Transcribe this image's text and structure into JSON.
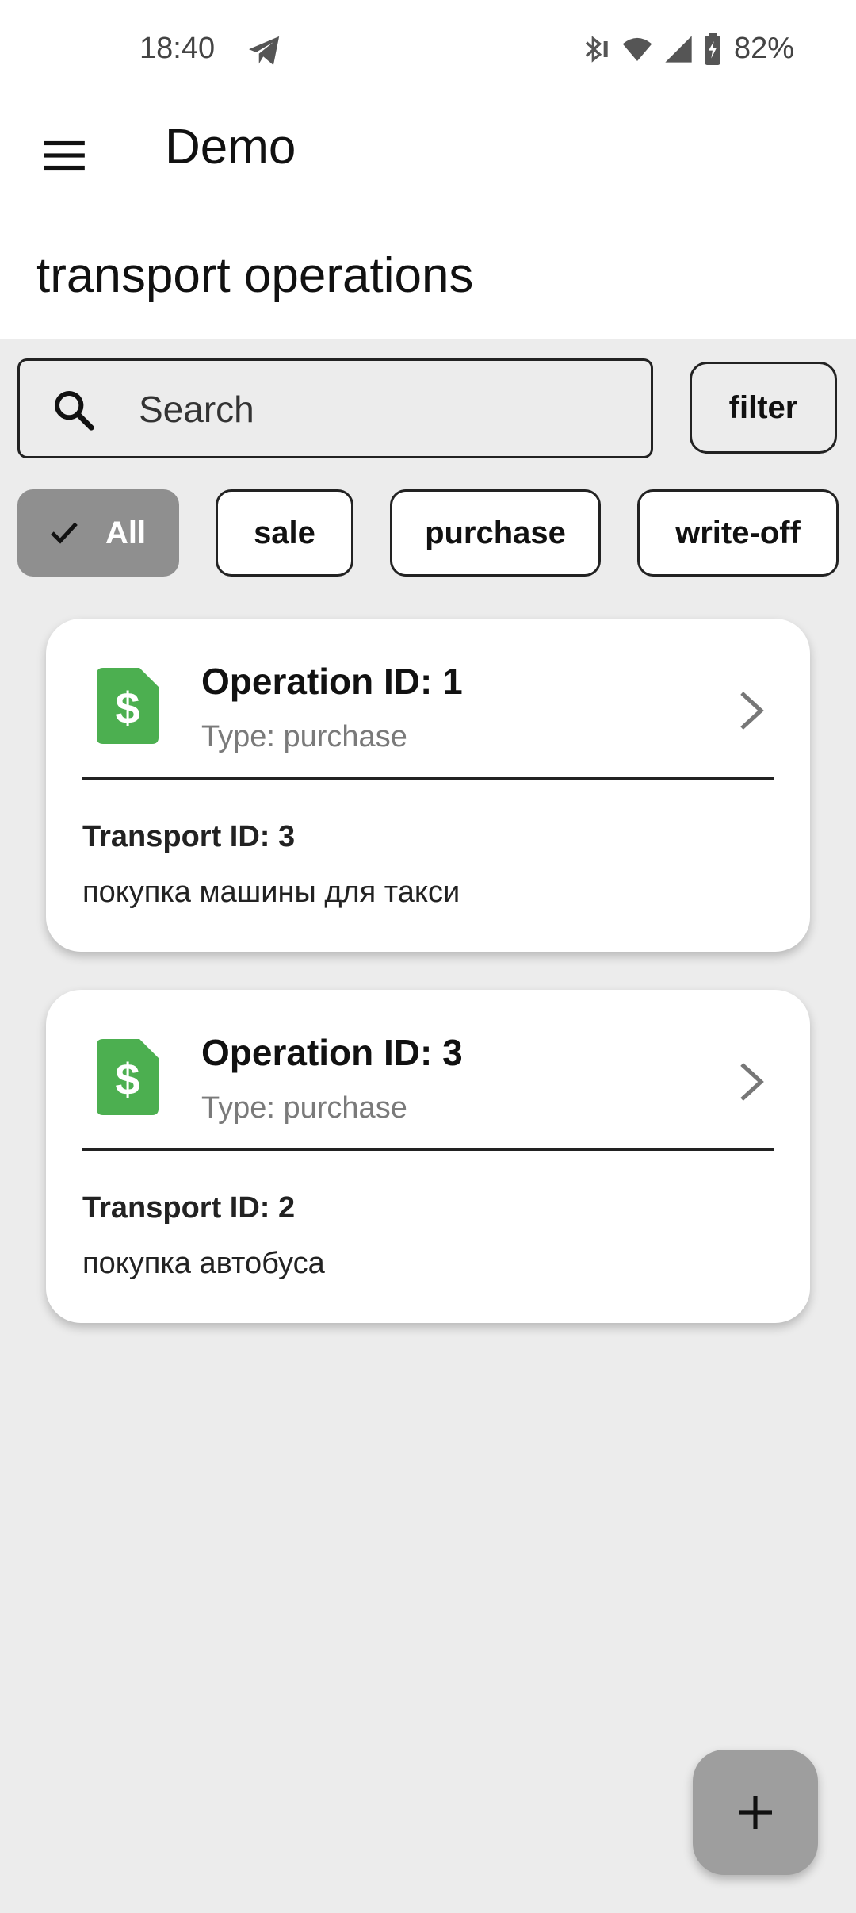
{
  "status_bar": {
    "time": "18:40",
    "battery": "82%",
    "icons": [
      "telegram-icon",
      "bluetooth-icon",
      "wifi-icon",
      "signal-icon",
      "battery-charging-icon"
    ]
  },
  "app_bar": {
    "title": "Demo",
    "menu_icon": "menu-icon"
  },
  "page": {
    "title": "transport operations"
  },
  "search": {
    "placeholder": "Search",
    "value": ""
  },
  "filter_label": "filter",
  "chips": [
    {
      "label": "All",
      "selected": true
    },
    {
      "label": "sale",
      "selected": false
    },
    {
      "label": "purchase",
      "selected": false
    },
    {
      "label": "write-off",
      "selected": false
    }
  ],
  "operations": [
    {
      "title": "Operation ID: 1",
      "type": "Type: purchase",
      "transport": "Transport ID: 3",
      "description": "покупка машины для такси"
    },
    {
      "title": "Operation ID: 3",
      "type": "Type: purchase",
      "transport": "Transport ID: 2",
      "description": "покупка автобуса"
    }
  ],
  "colors": {
    "accent_green": "#4caf50",
    "selected_chip": "#8f8f8f",
    "fab": "#9e9e9e",
    "background": "#ececec"
  }
}
